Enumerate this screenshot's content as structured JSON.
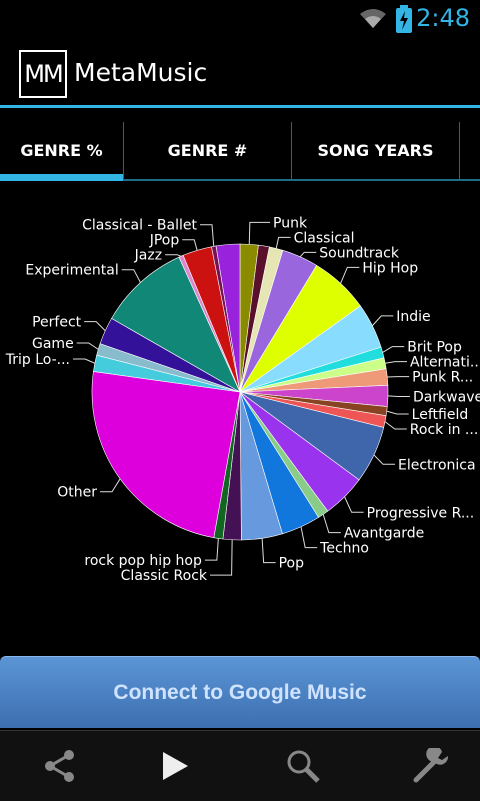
{
  "status": {
    "time": "2:48",
    "wifi_icon": "wifi-icon",
    "battery_icon": "battery-charging-icon"
  },
  "app": {
    "logo_text": "MM",
    "title": "MetaMusic"
  },
  "tabs": [
    {
      "label": "GENRE %",
      "selected": true
    },
    {
      "label": "GENRE #",
      "selected": false
    },
    {
      "label": "SONG YEARS",
      "selected": false
    }
  ],
  "chart_data": {
    "type": "pie",
    "slices": [
      {
        "label": "Punk",
        "value": 2.0,
        "color": "#8b8b00"
      },
      {
        "label": "",
        "value": 1.2,
        "color": "#5a0f2a"
      },
      {
        "label": "Classical",
        "value": 1.5,
        "color": "#e6e6b4"
      },
      {
        "label": "Soundtrack",
        "value": 4.0,
        "color": "#9966dd"
      },
      {
        "label": "Hip Hop",
        "value": 6.5,
        "color": "#ddff00"
      },
      {
        "label": "Indie",
        "value": 5.0,
        "color": "#88ddff"
      },
      {
        "label": "Brit Pop",
        "value": 1.2,
        "color": "#22dddd"
      },
      {
        "label": "Alternati...",
        "value": 1.2,
        "color": "#ccff88"
      },
      {
        "label": "Punk R...",
        "value": 1.8,
        "color": "#ee9977"
      },
      {
        "label": "Darkwave",
        "value": 2.3,
        "color": "#cc44cc"
      },
      {
        "label": "Leftfield",
        "value": 1.0,
        "color": "#884422"
      },
      {
        "label": "Rock in ...",
        "value": 1.3,
        "color": "#ee5555"
      },
      {
        "label": "Electronica",
        "value": 6.3,
        "color": "#3f66aa"
      },
      {
        "label": "Progressive R...",
        "value": 4.8,
        "color": "#9933ee"
      },
      {
        "label": "Avantgarde",
        "value": 1.2,
        "color": "#88cc88"
      },
      {
        "label": "Techno",
        "value": 4.3,
        "color": "#1177dd"
      },
      {
        "label": "Pop",
        "value": 4.5,
        "color": "#6699dd"
      },
      {
        "label": "Classic Rock",
        "value": 2.0,
        "color": "#441155"
      },
      {
        "label": "rock pop hip hop",
        "value": 1.0,
        "color": "#116622"
      },
      {
        "label": "Other",
        "value": 24.5,
        "color": "#dd00dd"
      },
      {
        "label": "Trip Lo-...",
        "value": 1.8,
        "color": "#44ccdd"
      },
      {
        "label": "Game",
        "value": 1.3,
        "color": "#88bbcc"
      },
      {
        "label": "Perfect",
        "value": 3.0,
        "color": "#331199"
      },
      {
        "label": "Experimental",
        "value": 10.0,
        "color": "#118877"
      },
      {
        "label": "Jazz",
        "value": 0.5,
        "color": "#dd88cc"
      },
      {
        "label": "JPop",
        "value": 3.2,
        "color": "#cc1111"
      },
      {
        "label": "Classical - Ballet",
        "value": 0.5,
        "color": "#771155"
      },
      {
        "label": "",
        "value": 2.6,
        "color": "#9922dd"
      }
    ]
  },
  "connect_button": {
    "label": "Connect to Google Music"
  },
  "bottom_bar": [
    "share-icon",
    "play-icon",
    "search-icon",
    "settings-wrench-icon"
  ]
}
